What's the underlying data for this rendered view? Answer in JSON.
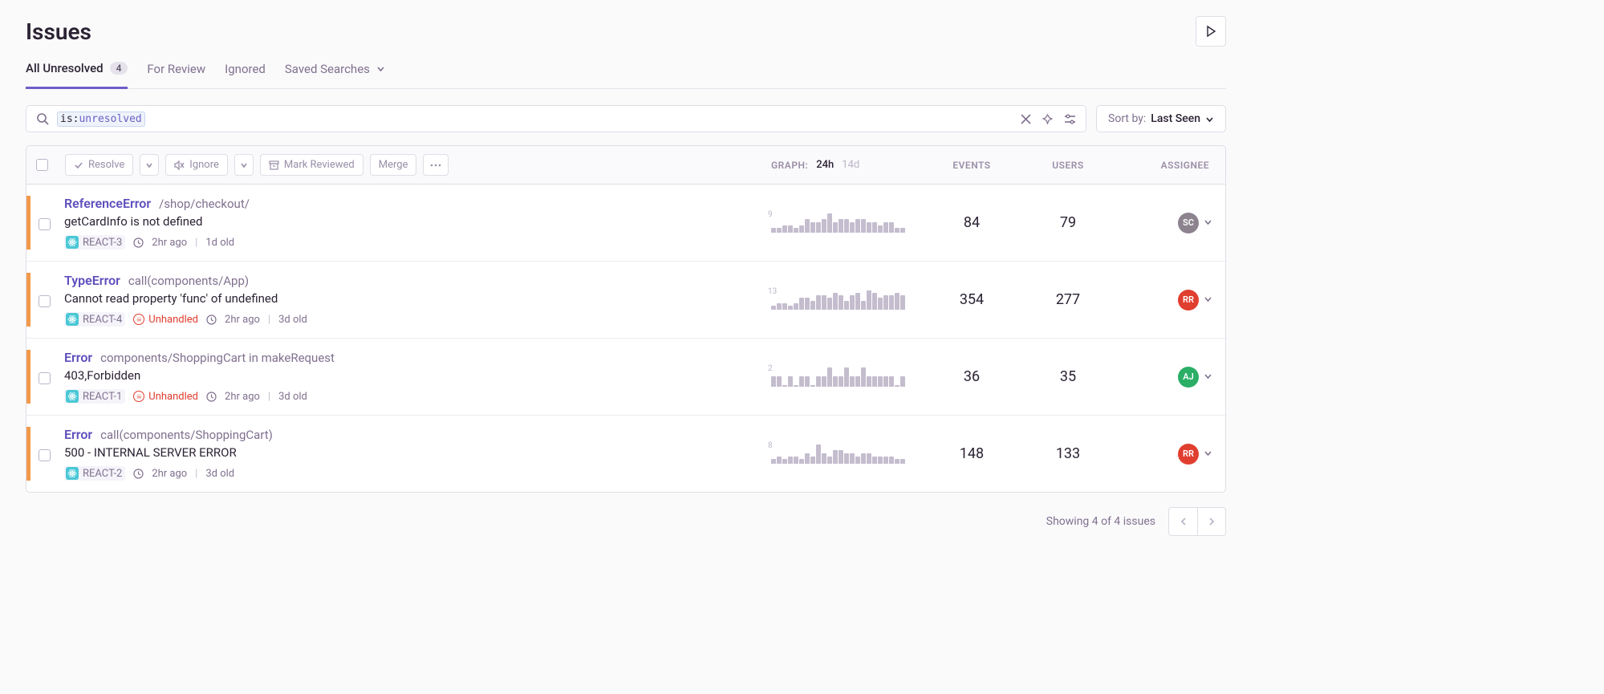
{
  "header": {
    "title": "Issues"
  },
  "tabs": {
    "items": [
      {
        "label": "All Unresolved",
        "badge": "4",
        "active": true
      },
      {
        "label": "For Review",
        "active": false
      },
      {
        "label": "Ignored",
        "active": false
      },
      {
        "label": "Saved Searches",
        "active": false,
        "dropdown": true
      }
    ]
  },
  "search": {
    "query_key": "is:",
    "query_val": "unresolved"
  },
  "sort": {
    "label": "Sort by:",
    "value": "Last Seen"
  },
  "bulk": {
    "resolve": "Resolve",
    "ignore": "Ignore",
    "mark_reviewed": "Mark Reviewed",
    "merge": "Merge"
  },
  "columns": {
    "graph": "GRAPH:",
    "graph_24h": "24h",
    "graph_14d": "14d",
    "events": "EVENTS",
    "users": "USERS",
    "assignee": "ASSIGNEE"
  },
  "issues": [
    {
      "type": "ReferenceError",
      "location": "/shop/checkout/",
      "message": "getCardInfo is not defined",
      "project": "REACT-3",
      "unhandled": false,
      "time": "2hr ago",
      "age": "1d old",
      "spark_max": "9",
      "spark": [
        1,
        1,
        2,
        2,
        1,
        2,
        4,
        3,
        3,
        4,
        6,
        3,
        4,
        4,
        3,
        4,
        4,
        3,
        3,
        2,
        3,
        3,
        1,
        1
      ],
      "events": "84",
      "users": "79",
      "assignee": {
        "initials": "SC",
        "color": "#8c838f"
      }
    },
    {
      "type": "TypeError",
      "location": "call(components/App)",
      "message": "Cannot read property 'func' of undefined",
      "project": "REACT-4",
      "unhandled": true,
      "unhandled_label": "Unhandled",
      "time": "2hr ago",
      "age": "3d old",
      "spark_max": "13",
      "spark": [
        1,
        2,
        2,
        1,
        2,
        4,
        4,
        3,
        5,
        5,
        4,
        6,
        5,
        3,
        5,
        6,
        3,
        7,
        6,
        4,
        5,
        5,
        6,
        5
      ],
      "events": "354",
      "users": "277",
      "assignee": {
        "initials": "RR",
        "color": "#e03e2f"
      }
    },
    {
      "type": "Error",
      "location": "components/ShoppingCart in makeRequest",
      "message": "403,Forbidden",
      "project": "REACT-1",
      "unhandled": true,
      "unhandled_label": "Unhandled",
      "time": "2hr ago",
      "age": "3d old",
      "spark_max": "2",
      "spark": [
        1,
        1,
        0,
        1,
        0,
        1,
        1,
        0,
        1,
        1,
        2,
        1,
        1,
        2,
        1,
        1,
        2,
        1,
        1,
        1,
        1,
        1,
        0,
        1
      ],
      "events": "36",
      "users": "35",
      "assignee": {
        "initials": "AJ",
        "color": "#2bae66"
      }
    },
    {
      "type": "Error",
      "location": "call(components/ShoppingCart)",
      "message": "500 - INTERNAL SERVER ERROR",
      "project": "REACT-2",
      "unhandled": false,
      "time": "2hr ago",
      "age": "3d old",
      "spark_max": "8",
      "spark": [
        1,
        2,
        1,
        2,
        2,
        1,
        3,
        2,
        6,
        3,
        2,
        4,
        4,
        3,
        3,
        2,
        3,
        3,
        2,
        2,
        2,
        2,
        1,
        1
      ],
      "events": "148",
      "users": "133",
      "assignee": {
        "initials": "RR",
        "color": "#e03e2f"
      }
    }
  ],
  "footer": {
    "summary": "Showing 4 of 4 issues"
  }
}
